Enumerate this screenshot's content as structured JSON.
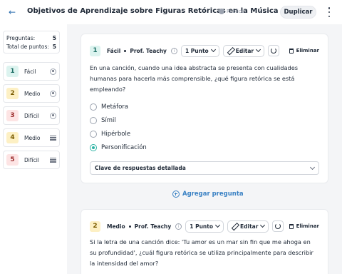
{
  "header": {
    "title": "Objetivos de Aprendizaje sobre Figuras Retóricas en la Música",
    "visibility": "Público",
    "duplicate_label": "Duplicar"
  },
  "sidebar": {
    "stats": {
      "questions_label": "Preguntas:",
      "questions_value": "5",
      "points_label": "Total de puntos:",
      "points_value": "5"
    },
    "items": [
      {
        "number": "1",
        "label": "Fácil",
        "icon": "radio-icon",
        "color": "#dcf3ef",
        "text_color": "#1f6f66"
      },
      {
        "number": "2",
        "label": "Medio",
        "icon": "radio-icon",
        "color": "#fdf0c4",
        "text_color": "#7a5b00"
      },
      {
        "number": "3",
        "label": "Difícil",
        "icon": "radio-icon",
        "color": "#fde4e4",
        "text_color": "#9b2c2c"
      },
      {
        "number": "4",
        "label": "Medio",
        "icon": "lines-icon",
        "color": "#fdf0c4",
        "text_color": "#7a5b00"
      },
      {
        "number": "5",
        "label": "Difícil",
        "icon": "lines-icon",
        "color": "#fde4e4",
        "text_color": "#9b2c2c"
      }
    ]
  },
  "questions": [
    {
      "number": "1",
      "difficulty": "Fácil",
      "author": "Prof. Teachy",
      "points": "1 Punto",
      "edit_label": "Editar",
      "delete_label": "Eliminar",
      "text": "En una canción, cuando una idea abstracta se presenta con cualidades humanas para hacerla más comprensible, ¿qué figura retórica se está empleando?",
      "options": [
        {
          "label": "Metáfora",
          "selected": false
        },
        {
          "label": "Símil",
          "selected": false
        },
        {
          "label": "Hipérbole",
          "selected": false
        },
        {
          "label": "Personificación",
          "selected": true
        }
      ],
      "answer_key_label": "Clave de respuestas detallada"
    },
    {
      "number": "2",
      "difficulty": "Medio",
      "author": "Prof. Teachy",
      "points": "1 Punto",
      "edit_label": "Editar",
      "delete_label": "Eliminar",
      "text": "Si la letra de una canción dice: 'Tu amor es un mar sin fin que me ahoga en su profundidad', ¿cuál figura retórica se utiliza principalmente para describir la intensidad del amor?"
    }
  ],
  "add_question_label": "Agregar pregunta",
  "colors": {
    "accent": "#3b82c4",
    "selected": "#2db3a4",
    "easy_badge": "#dcf3ef",
    "medium_badge": "#fdf0c4",
    "hard_badge": "#fde4e4"
  }
}
